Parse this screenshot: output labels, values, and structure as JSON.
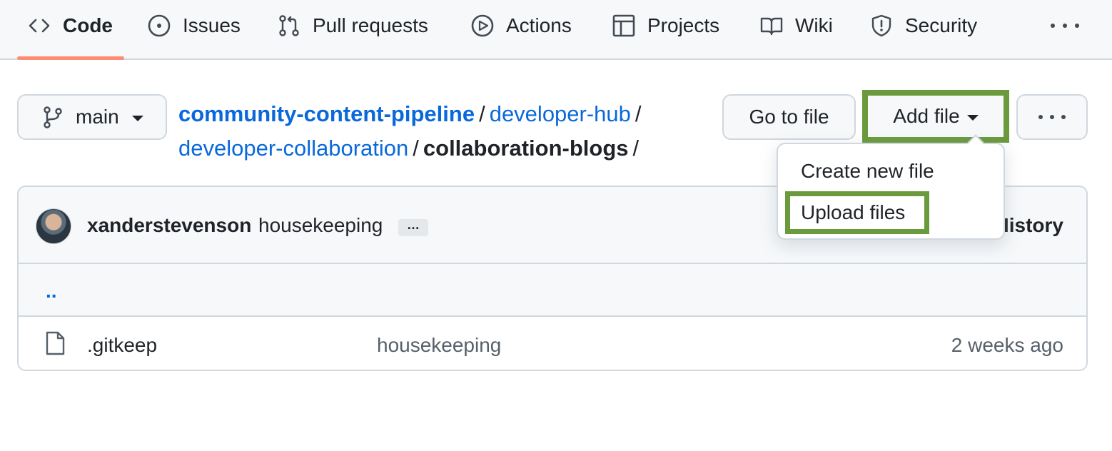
{
  "nav": {
    "tabs": [
      {
        "label": "Code",
        "icon": "code-icon",
        "active": true
      },
      {
        "label": "Issues",
        "icon": "issue-circle-icon",
        "active": false
      },
      {
        "label": "Pull requests",
        "icon": "pull-request-icon",
        "active": false
      },
      {
        "label": "Actions",
        "icon": "play-icon",
        "active": false
      },
      {
        "label": "Projects",
        "icon": "table-icon",
        "active": false
      },
      {
        "label": "Wiki",
        "icon": "book-icon",
        "active": false
      },
      {
        "label": "Security",
        "icon": "shield-icon",
        "active": false
      }
    ],
    "more_icon": "kebab-horizontal-icon",
    "active_underline_color": "#fd8c73"
  },
  "branch": {
    "name": "main",
    "icon": "git-branch-icon"
  },
  "breadcrumb": {
    "repo": "community-content-pipeline",
    "path": [
      "developer-hub",
      "developer-collaboration"
    ],
    "current": "collaboration-blogs",
    "separator": "/"
  },
  "actions": {
    "goto_label": "Go to file",
    "add_file_label": "Add file",
    "highlight_color": "#6a9a3c"
  },
  "dropdown": {
    "items": [
      "Create new file",
      "Upload files"
    ]
  },
  "commit": {
    "author": "xanderstevenson",
    "message": "housekeeping",
    "ellipsis": "…",
    "history_label": "History"
  },
  "files": {
    "up_link": "..",
    "rows": [
      {
        "name": ".gitkeep",
        "message": "housekeeping",
        "date": "2 weeks ago",
        "icon": "file-icon"
      }
    ]
  },
  "colors": {
    "link": "#0969da",
    "muted": "#57606a",
    "border": "#d0d7de",
    "subtle_bg": "#f6f8fa"
  }
}
